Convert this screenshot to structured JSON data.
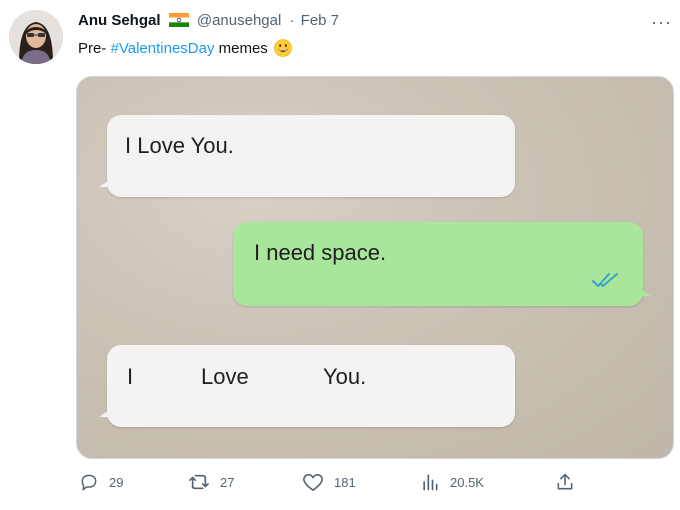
{
  "tweet": {
    "author_name": "Anu Sehgal",
    "handle": "@anusehgal",
    "separator": "·",
    "date": "Feb 7",
    "more_label": "···",
    "text_prefix": "Pre- ",
    "hashtag": "#ValentinesDay",
    "text_suffix": " memes",
    "emoji": "grinning-face-emoji",
    "flag": "india-flag-icon"
  },
  "media": {
    "messages": [
      {
        "side": "left",
        "text": "I Love You."
      },
      {
        "side": "right",
        "text": "I need space.",
        "status": "read-ticks-icon"
      },
      {
        "side": "left",
        "words": [
          "I",
          "Love",
          "You."
        ]
      }
    ],
    "colors": {
      "incoming": "#f4f3f1",
      "outgoing": "#a9e59a",
      "ticks": "#3aa1c9"
    }
  },
  "actions": {
    "replies": "29",
    "retweets": "27",
    "likes": "181",
    "views": "20.5K"
  },
  "colors": {
    "link": "#1d9bf0",
    "muted": "#536471"
  }
}
